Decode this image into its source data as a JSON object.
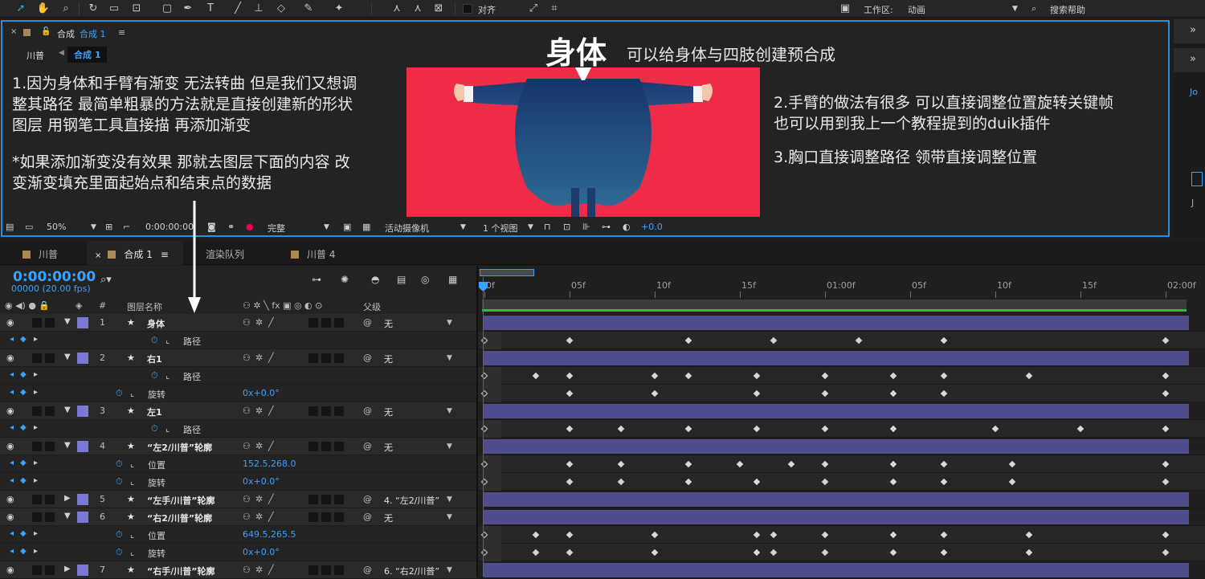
{
  "toolbar": {
    "align_label": "对齐",
    "workspace_label": "工作区:",
    "workspace_value": "动画",
    "search_help": "搜索帮助"
  },
  "comp_panel": {
    "tab_label": "合成",
    "tab_comp": "合成 1",
    "menu_icon": "≡",
    "breadcrumb_parent": "川普",
    "breadcrumb_current": "合成 1",
    "title": "身体",
    "subtitle": "可以给身体与四肢创建预合成",
    "note_left": [
      "1.因为身体和手臂有渐变 无法转曲 但是我们又想调",
      "整其路径 最简单粗暴的方法就是直接创建新的形状",
      "图层 用钢笔工具直接描 再添加渐变",
      "",
      "*如果添加渐变没有效果 那就去图层下面的内容 改",
      "变渐变填充里面起始点和结束点的数据"
    ],
    "note_right": [
      "2.手臂的做法有很多 可以直接调整位置旋转关键帧",
      "也可以用到我上一个教程提到的duik插件",
      "",
      "3.胸口直接调整路径 领带直接调整位置"
    ],
    "viewer_bar": {
      "zoom": "50%",
      "time": "0:00:00:00",
      "quality": "完整",
      "camera": "活动摄像机",
      "views": "1 个视图",
      "exposure": "+0.0"
    }
  },
  "right_strip": {
    "label_jo": "Jo",
    "label_j": "J"
  },
  "timeline_tabs": [
    {
      "label": "川普",
      "active": false
    },
    {
      "label": "合成 1",
      "active": true
    },
    {
      "label": "渲染队列",
      "active": false
    },
    {
      "label": "川普 4",
      "active": false
    }
  ],
  "timeline": {
    "timecode": "0:00:00:00",
    "timecode_sub": "00000 (20.00 fps)",
    "col_layer_name": "图层名称",
    "col_parent": "父级",
    "col_hash": "#",
    "ruler_labels": [
      "0f",
      "05f",
      "10f",
      "15f",
      "01:00f",
      "05f",
      "10f",
      "15f",
      "02:00f"
    ],
    "rows": [
      {
        "type": "layer",
        "num": "1",
        "name": "身体",
        "parent": "无",
        "expanded": true
      },
      {
        "type": "prop",
        "name": "路径",
        "value": "",
        "graph_icon": true
      },
      {
        "type": "layer",
        "num": "2",
        "name": "右1",
        "parent": "无",
        "expanded": true
      },
      {
        "type": "prop",
        "name": "路径",
        "value": "",
        "graph_icon": true
      },
      {
        "type": "prop",
        "name": "旋转",
        "value": "0x+0.0°"
      },
      {
        "type": "layer",
        "num": "3",
        "name": "左1",
        "parent": "无",
        "expanded": true
      },
      {
        "type": "prop",
        "name": "路径",
        "value": "",
        "graph_icon": true
      },
      {
        "type": "layer",
        "num": "4",
        "name": "“左2/川普”轮廓",
        "parent": "无",
        "expanded": true
      },
      {
        "type": "prop",
        "name": "位置",
        "value": "152.5,268.0"
      },
      {
        "type": "prop",
        "name": "旋转",
        "value": "0x+0.0°"
      },
      {
        "type": "layer",
        "num": "5",
        "name": "“左手/川普”轮廓",
        "parent": "4. “左2/川普”",
        "expanded": false
      },
      {
        "type": "layer",
        "num": "6",
        "name": "“右2/川普”轮廓",
        "parent": "无",
        "expanded": true
      },
      {
        "type": "prop",
        "name": "位置",
        "value": "649.5,265.5"
      },
      {
        "type": "prop",
        "name": "旋转",
        "value": "0x+0.0°"
      },
      {
        "type": "layer",
        "num": "7",
        "name": "“右手/川普”轮廓",
        "parent": "6. “右2/川普”",
        "expanded": false
      }
    ],
    "keyframes": [
      [],
      [
        0,
        5,
        12,
        17,
        22,
        27,
        40
      ],
      [],
      [
        0,
        3,
        5,
        10,
        12,
        16,
        20,
        24,
        27,
        32,
        40
      ],
      [
        0,
        5,
        10,
        16,
        20,
        24,
        27,
        40
      ],
      [],
      [
        0,
        5,
        8,
        12,
        16,
        20,
        24,
        30,
        35,
        40
      ],
      [],
      [
        0,
        5,
        8,
        12,
        15,
        18,
        20,
        24,
        27,
        31,
        40
      ],
      [
        0,
        5,
        8,
        12,
        16,
        20,
        24,
        27,
        31,
        40
      ],
      [],
      [],
      [
        0,
        3,
        5,
        10,
        16,
        17,
        20,
        24,
        27,
        32,
        40
      ],
      [
        0,
        3,
        5,
        10,
        16,
        17,
        20,
        24,
        27,
        32,
        40
      ],
      []
    ]
  }
}
